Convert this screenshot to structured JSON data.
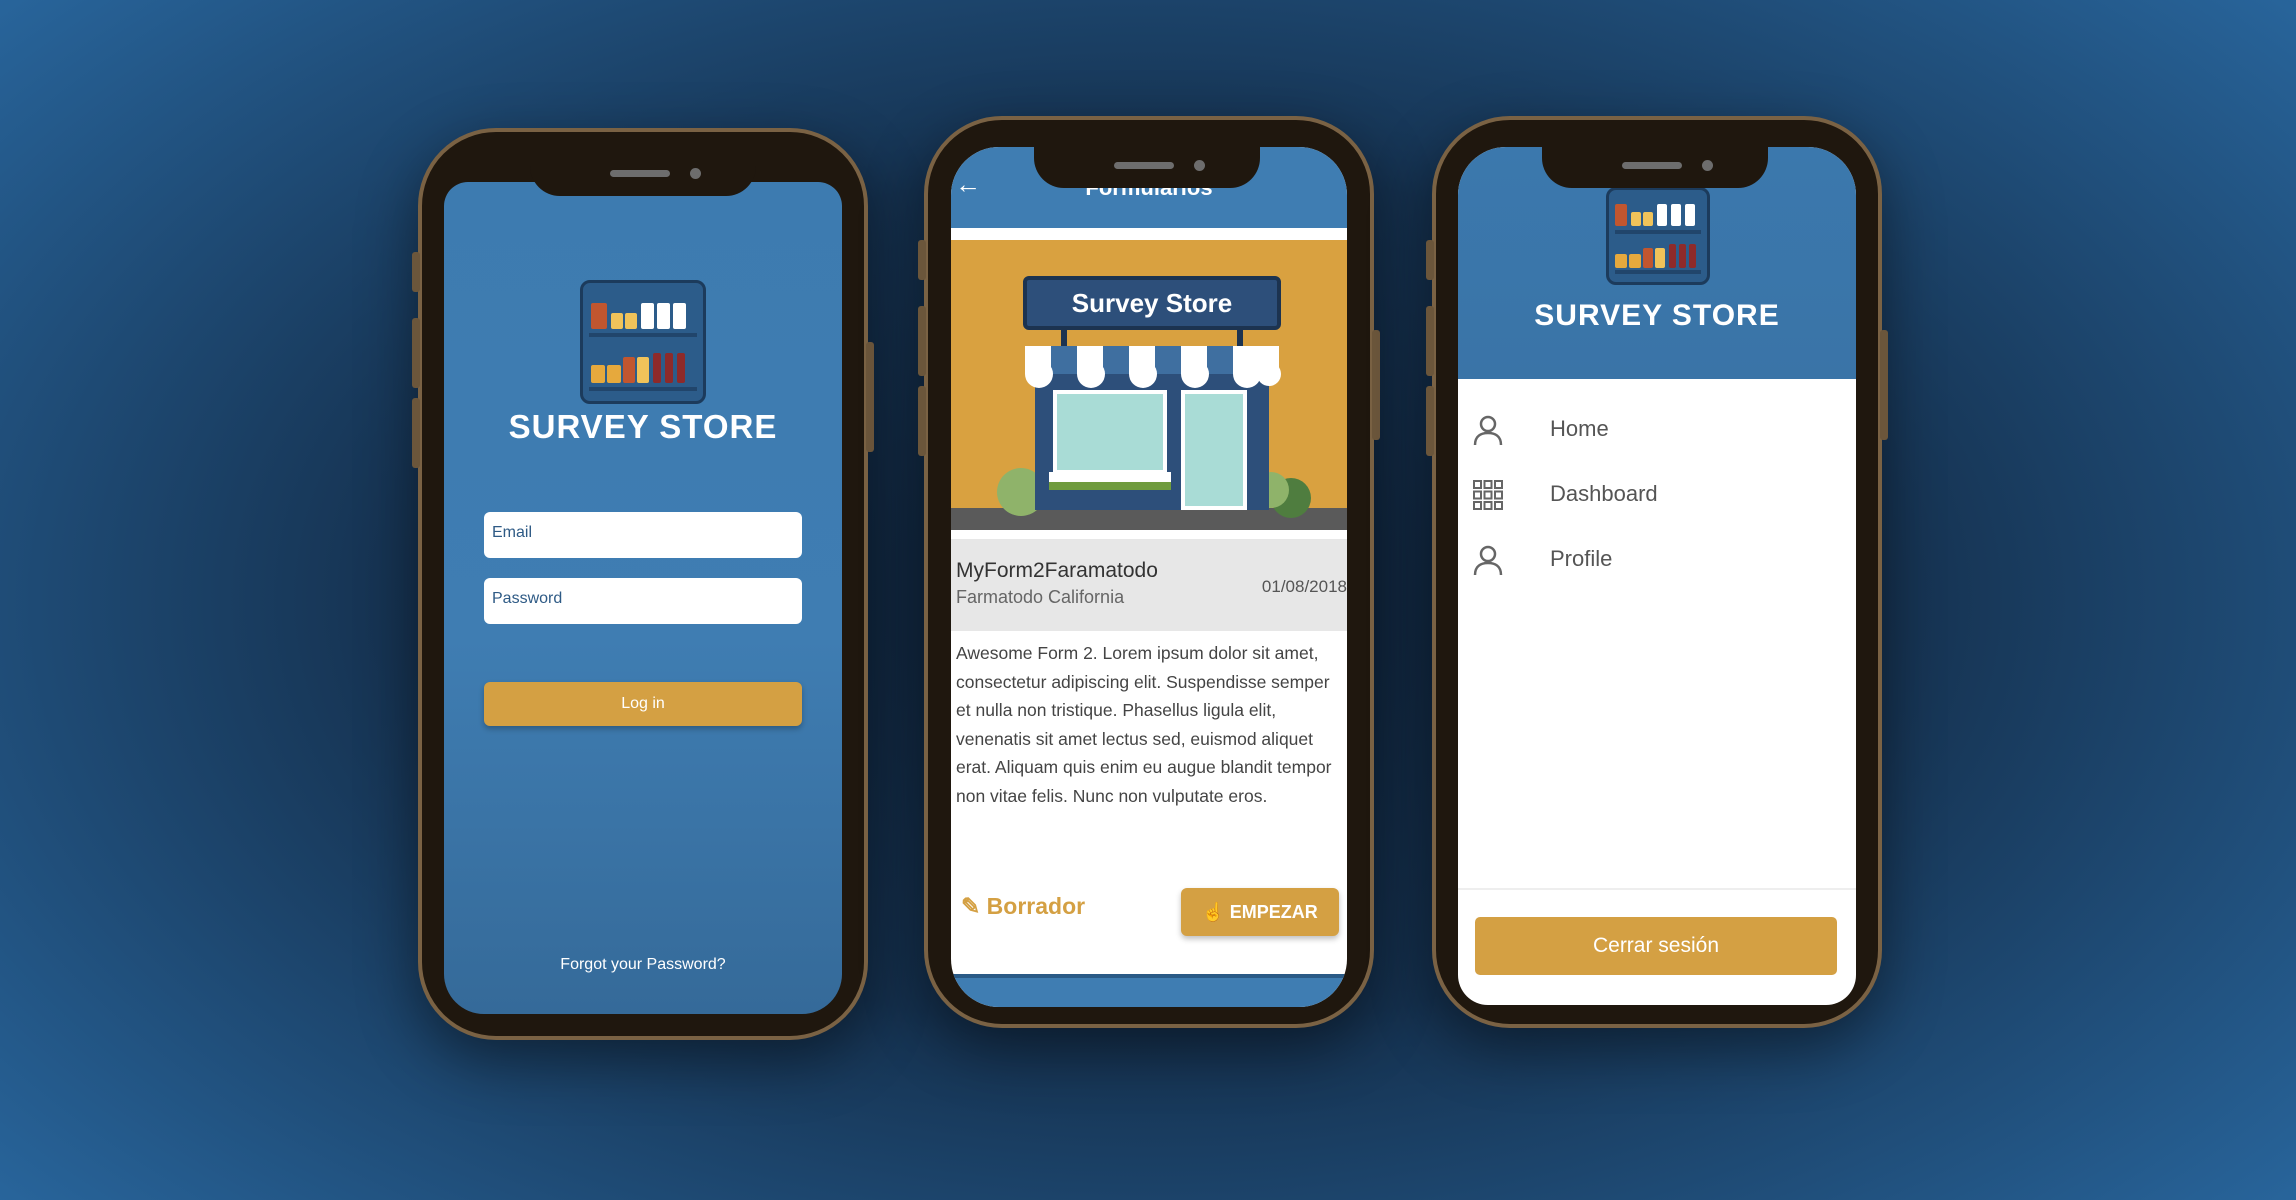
{
  "colors": {
    "brand_blue": "#3f7db2",
    "accent_gold": "#d4a043",
    "phone_frame": "#7a6244"
  },
  "login": {
    "logo_text": "SURVEY STORE",
    "email_placeholder": "Email",
    "password_placeholder": "Password",
    "login_label": "Log in",
    "forgot_label": "Forgot your Password?"
  },
  "forms": {
    "back_icon": "arrow-left-icon",
    "title": "Formularios",
    "hero_sign": "Survey Store",
    "card": {
      "name": "MyForm2Faramatodo",
      "store": "Farmatodo California",
      "date": "01/08/2018",
      "description": "Awesome Form 2. Lorem ipsum dolor sit amet, consectetur adipiscing elit. Suspendisse semper et nulla non tristique. Phasellus ligula elit, venenatis sit amet lectus sed, euismod aliquet erat. Aliquam quis enim eu augue blandit tempor non vitae felis. Nunc non vulputate eros.",
      "draft_label": "Borrador",
      "start_label": "EMPEZAR"
    }
  },
  "drawer": {
    "logo_text": "SURVEY STORE",
    "items": [
      {
        "label": "Home",
        "icon": "person-icon"
      },
      {
        "label": "Dashboard",
        "icon": "grid-icon"
      },
      {
        "label": "Profile",
        "icon": "person-icon"
      }
    ],
    "logout_label": "Cerrar sesión"
  }
}
